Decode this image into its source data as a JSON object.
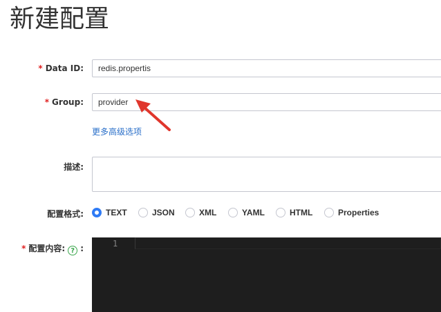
{
  "page": {
    "title": "新建配置"
  },
  "form": {
    "data_id": {
      "label": "Data ID:",
      "value": "redis.propertis",
      "required": true
    },
    "group": {
      "label": "Group:",
      "value": "provider",
      "required": true
    },
    "advanced_link": "更多高级选项",
    "description": {
      "label": "描述:",
      "value": ""
    },
    "format": {
      "label": "配置格式:",
      "options": [
        "TEXT",
        "JSON",
        "XML",
        "YAML",
        "HTML",
        "Properties"
      ],
      "selected": "TEXT"
    },
    "content": {
      "label": "配置内容:",
      "colon": ":",
      "required": true,
      "help_icon": "question-circle-icon",
      "line_number": "1"
    }
  },
  "required_mark": "*",
  "colors": {
    "accent": "#2f7bf5",
    "link": "#2a6fc9",
    "required": "#e02020",
    "annotation_arrow": "#e0362c",
    "editor_bg": "#1e1e1e"
  }
}
